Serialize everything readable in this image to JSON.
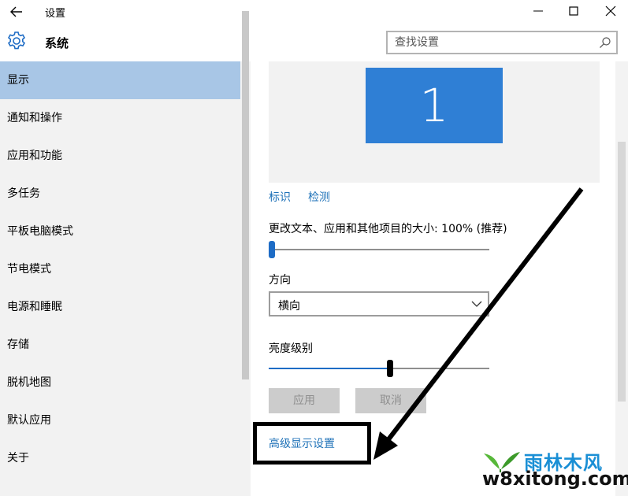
{
  "window": {
    "title": "设置"
  },
  "header": {
    "title": "系统",
    "search_placeholder": "查找设置"
  },
  "sidebar": {
    "items": [
      {
        "label": "显示",
        "active": true
      },
      {
        "label": "通知和操作"
      },
      {
        "label": "应用和功能"
      },
      {
        "label": "多任务"
      },
      {
        "label": "平板电脑模式"
      },
      {
        "label": "节电模式"
      },
      {
        "label": "电源和睡眠"
      },
      {
        "label": "存储"
      },
      {
        "label": "脱机地图"
      },
      {
        "label": "默认应用"
      },
      {
        "label": "关于"
      }
    ]
  },
  "display": {
    "monitor_number": "1",
    "identify_link": "标识",
    "detect_link": "检测",
    "scale_label": "更改文本、应用和其他项目的大小: 100% (推荐)",
    "scale_level": 0.0,
    "orientation_label": "方向",
    "orientation_value": "横向",
    "brightness_label": "亮度级别",
    "brightness_level": 0.55,
    "apply_button": "应用",
    "cancel_button": "取消",
    "advanced_link": "高级显示设置"
  },
  "watermark": {
    "cn_text": "雨林木风",
    "url_text": "w8xitong.com"
  },
  "colors": {
    "accent": "#2f7fd5",
    "sidebar_active": "#a8c6e6",
    "link": "#1f72b8"
  }
}
